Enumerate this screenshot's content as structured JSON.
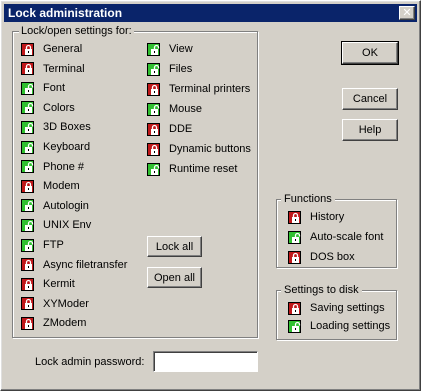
{
  "window": {
    "title": "Lock administration",
    "close_symbol": "✕"
  },
  "lock_group": {
    "label": "Lock/open settings for:",
    "left_items": [
      {
        "label": "General",
        "state": "locked"
      },
      {
        "label": "Terminal",
        "state": "locked"
      },
      {
        "label": "Font",
        "state": "open"
      },
      {
        "label": "Colors",
        "state": "open"
      },
      {
        "label": "3D Boxes",
        "state": "open"
      },
      {
        "label": "Keyboard",
        "state": "open"
      },
      {
        "label": "Phone #",
        "state": "open"
      },
      {
        "label": "Modem",
        "state": "locked"
      },
      {
        "label": "Autologin",
        "state": "open"
      },
      {
        "label": "UNIX Env",
        "state": "open"
      },
      {
        "label": "FTP",
        "state": "open"
      },
      {
        "label": "Async filetransfer",
        "state": "locked"
      },
      {
        "label": "Kermit",
        "state": "locked"
      },
      {
        "label": "XYModer",
        "state": "locked"
      },
      {
        "label": "ZModem",
        "state": "locked"
      }
    ],
    "right_items": [
      {
        "label": "View",
        "state": "open"
      },
      {
        "label": "Files",
        "state": "open"
      },
      {
        "label": "Terminal printers",
        "state": "locked"
      },
      {
        "label": "Mouse",
        "state": "open"
      },
      {
        "label": "DDE",
        "state": "locked"
      },
      {
        "label": "Dynamic buttons",
        "state": "locked"
      },
      {
        "label": "Runtime reset",
        "state": "open"
      }
    ],
    "lock_all_label": "Lock all",
    "open_all_label": "Open all"
  },
  "buttons": {
    "ok": "OK",
    "cancel": "Cancel",
    "help": "Help"
  },
  "functions_group": {
    "label": "Functions",
    "items": [
      {
        "label": "History",
        "state": "locked"
      },
      {
        "label": "Auto-scale font",
        "state": "open"
      },
      {
        "label": "DOS box",
        "state": "locked"
      }
    ]
  },
  "disk_group": {
    "label": "Settings to disk",
    "items": [
      {
        "label": "Saving settings",
        "state": "locked"
      },
      {
        "label": "Loading settings",
        "state": "open"
      }
    ]
  },
  "password": {
    "label": "Lock admin password:",
    "value": ""
  },
  "colors": {
    "locked": "#c0181a",
    "open": "#30c030",
    "titlebar": "#0a246a"
  }
}
